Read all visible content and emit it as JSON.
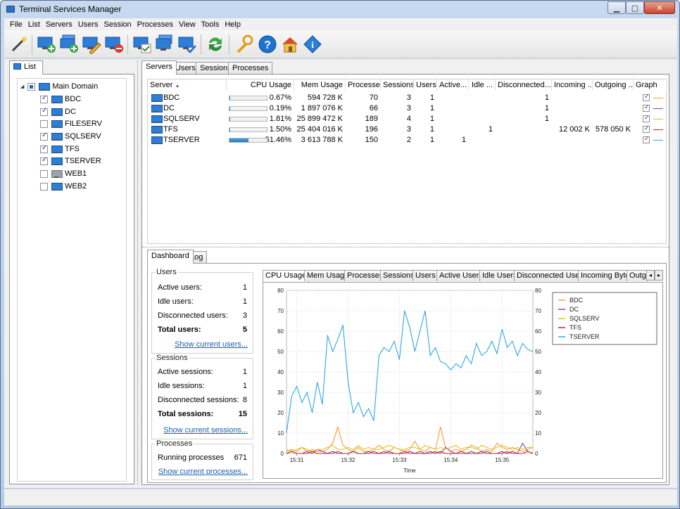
{
  "window": {
    "title": "Terminal Services Manager",
    "btn_min": "▁",
    "btn_max": "▢",
    "btn_close": "✕"
  },
  "menu": [
    "File",
    "List",
    "Servers",
    "Users",
    "Session",
    "Processes",
    "View",
    "Tools",
    "Help"
  ],
  "toolbar": [
    {
      "icon": "wand-icon"
    },
    {
      "icon": "add-server-icon"
    },
    {
      "icon": "add-domain-icon"
    },
    {
      "icon": "edit-server-icon"
    },
    {
      "icon": "remove-server-icon"
    },
    {
      "icon": "connect-icon"
    },
    {
      "icon": "connect-all-icon"
    },
    {
      "icon": "check-servers-icon"
    },
    {
      "icon": "refresh-icon"
    },
    {
      "icon": "options-icon"
    },
    {
      "icon": "help-icon"
    },
    {
      "icon": "home-icon"
    },
    {
      "icon": "info-icon"
    }
  ],
  "left_panel": {
    "tab": "List",
    "root": {
      "label": "Main Domain",
      "expander": "◢"
    },
    "servers": [
      {
        "name": "BDC",
        "checked": true,
        "online": true
      },
      {
        "name": "DC",
        "checked": true,
        "online": true
      },
      {
        "name": "FILESERV",
        "checked": false,
        "online": true
      },
      {
        "name": "SQLSERV",
        "checked": true,
        "online": true
      },
      {
        "name": "TFS",
        "checked": true,
        "online": true
      },
      {
        "name": "TSERVER",
        "checked": true,
        "online": true
      },
      {
        "name": "WEB1",
        "checked": false,
        "online": false
      },
      {
        "name": "WEB2",
        "checked": false,
        "online": true
      }
    ]
  },
  "top_tabs": [
    "Servers",
    "Users",
    "Sessions",
    "Processes"
  ],
  "servers_table": {
    "columns": [
      "Server",
      "CPU Usage",
      "Mem Usage",
      "Processes",
      "Sessions",
      "Users",
      "Active...",
      "Idle ...",
      "Disconnected...",
      "Incoming ...",
      "Outgoing ...",
      "Graph"
    ],
    "sort_indicator": "▲",
    "rows": [
      {
        "server": "BDC",
        "cpu": "0.67%",
        "cpu_value": 0.67,
        "mem": "594 728 K",
        "processes": "70",
        "sessions": "3",
        "users": "1",
        "active": "",
        "idle": "",
        "disconnected": "1",
        "incoming": "",
        "outgoing": "",
        "graph_color": "#f0a030"
      },
      {
        "server": "DC",
        "cpu": "0.19%",
        "cpu_value": 0.19,
        "mem": "1 897 076 K",
        "processes": "66",
        "sessions": "3",
        "users": "1",
        "active": "",
        "idle": "",
        "disconnected": "1",
        "incoming": "",
        "outgoing": "",
        "graph_color": "#8b3fb0"
      },
      {
        "server": "SQLSERV",
        "cpu": "1.81%",
        "cpu_value": 1.81,
        "mem": "25 899 472 K",
        "processes": "189",
        "sessions": "4",
        "users": "1",
        "active": "",
        "idle": "",
        "disconnected": "1",
        "incoming": "",
        "outgoing": "",
        "graph_color": "#e8c020"
      },
      {
        "server": "TFS",
        "cpu": "1.50%",
        "cpu_value": 1.5,
        "mem": "25 404 016 K",
        "processes": "196",
        "sessions": "3",
        "users": "1",
        "active": "",
        "idle": "1",
        "disconnected": "",
        "incoming": "12 002 K",
        "outgoing": "578 050 K",
        "graph_color": "#d02020"
      },
      {
        "server": "TSERVER",
        "cpu": "51.46%",
        "cpu_value": 51.46,
        "mem": "3 613 788 K",
        "processes": "150",
        "sessions": "2",
        "users": "1",
        "active": "1",
        "idle": "",
        "disconnected": "",
        "incoming": "",
        "outgoing": "",
        "graph_color": "#30a8e0"
      }
    ]
  },
  "bottom_tabs": [
    "Dashboard",
    "Log"
  ],
  "dashboard": {
    "users": {
      "title": "Users",
      "active_label": "Active users:",
      "active": "1",
      "idle_label": "Idle users:",
      "idle": "1",
      "disc_label": "Disconnected users:",
      "disc": "3",
      "total_label": "Total users:",
      "total": "5",
      "link": "Show current users..."
    },
    "sessions": {
      "title": "Sessions",
      "active_label": "Active sessions:",
      "active": "1",
      "idle_label": "Idle sessions:",
      "idle": "1",
      "disc_label": "Disconnected sessions:",
      "disc": "8",
      "total_label": "Total sessions:",
      "total": "15",
      "link": "Show current sessions..."
    },
    "processes": {
      "title": "Processes",
      "running_label": "Running processes",
      "running": "671",
      "link": "Show current processes..."
    }
  },
  "chart_tabs": [
    "CPU Usage",
    "Mem Usage",
    "Processes",
    "Sessions",
    "Users",
    "Active Users",
    "Idle Users",
    "Disconnected Users",
    "Incoming Bytes",
    "Outg"
  ],
  "chart_scroll": {
    "left": "◂",
    "right": "▸"
  },
  "chart_data": {
    "type": "line",
    "xlabel": "Time",
    "ylabel": "",
    "ylim": [
      0,
      80
    ],
    "yticks": [
      0,
      10,
      20,
      30,
      40,
      50,
      60,
      70,
      80
    ],
    "xticks": [
      "15:31",
      "15:32",
      "15:33",
      "15:34",
      "15:35"
    ],
    "xtick_positions": [
      2,
      12,
      22,
      32,
      42
    ],
    "xlim": [
      0,
      48
    ],
    "grid": true,
    "legend_position": "top-right",
    "series": [
      {
        "name": "BDC",
        "color": "#f0a030",
        "values": [
          1,
          2,
          1,
          3,
          1,
          2,
          1,
          1,
          2,
          5,
          13,
          4,
          2,
          1,
          3,
          1,
          1,
          2,
          4,
          2,
          1,
          3,
          2,
          1,
          2,
          6,
          2,
          1,
          3,
          2,
          13,
          3,
          1,
          2,
          1,
          2,
          4,
          3,
          1,
          2,
          1,
          5,
          3,
          2,
          3,
          2,
          1,
          2,
          3
        ]
      },
      {
        "name": "DC",
        "color": "#8b3fb0",
        "values": [
          0,
          1,
          0,
          0,
          1,
          0,
          2,
          1,
          0,
          0,
          1,
          0,
          0,
          1,
          0,
          0,
          1,
          0,
          0,
          1,
          0,
          0,
          0,
          1,
          0,
          0,
          1,
          0,
          0,
          1,
          0,
          3,
          1,
          0,
          0,
          0,
          1,
          0,
          0,
          1,
          0,
          0,
          0,
          1,
          0,
          0,
          5,
          1,
          0
        ]
      },
      {
        "name": "SQLSERV",
        "color": "#e8c020",
        "values": [
          2,
          1,
          2,
          3,
          2,
          1,
          2,
          2,
          3,
          4,
          2,
          2,
          3,
          2,
          4,
          2,
          3,
          2,
          2,
          3,
          4,
          3,
          2,
          2,
          3,
          3,
          2,
          4,
          3,
          2,
          3,
          2,
          3,
          4,
          2,
          3,
          3,
          2,
          4,
          3,
          2,
          3,
          4,
          3,
          2,
          3,
          2,
          3,
          3
        ]
      },
      {
        "name": "TFS",
        "color": "#d02020",
        "values": [
          0,
          1,
          0,
          0,
          0,
          1,
          0,
          0,
          0,
          1,
          0,
          0,
          0,
          1,
          0,
          0,
          0,
          1,
          0,
          0,
          1,
          0,
          0,
          0,
          1,
          0,
          0,
          0,
          1,
          0,
          1,
          0,
          0,
          0,
          1,
          0,
          0,
          0,
          1,
          0,
          0,
          0,
          1,
          0,
          1,
          0,
          0,
          1,
          0
        ]
      },
      {
        "name": "TSERVER",
        "color": "#30a8e0",
        "values": [
          10,
          28,
          33,
          25,
          30,
          20,
          35,
          24,
          58,
          50,
          56,
          63,
          35,
          20,
          25,
          18,
          22,
          16,
          48,
          52,
          50,
          55,
          46,
          70,
          62,
          50,
          60,
          70,
          48,
          52,
          45,
          44,
          41,
          44,
          42,
          48,
          44,
          54,
          48,
          50,
          55,
          49,
          61,
          52,
          55,
          48,
          54,
          51,
          50
        ]
      }
    ]
  }
}
